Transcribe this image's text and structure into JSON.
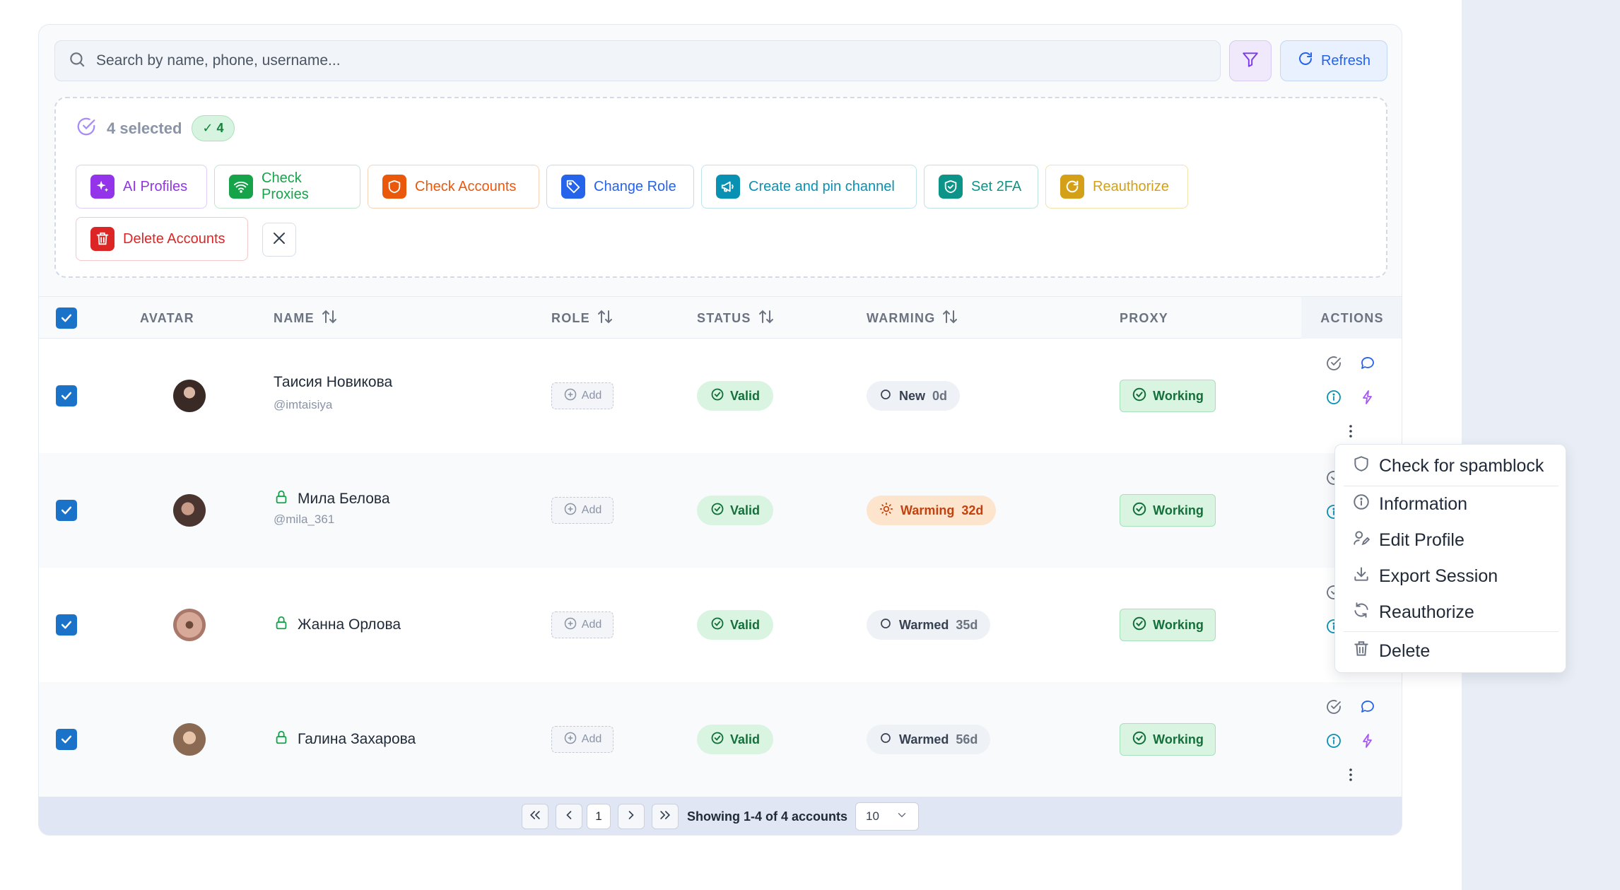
{
  "search": {
    "placeholder": "Search by name, phone, username..."
  },
  "toolbar": {
    "refresh_label": "Refresh"
  },
  "selection": {
    "count_label": "4 selected",
    "badge_label": "✓ 4",
    "actions": [
      {
        "label": "AI Profiles",
        "color": "#9333ea",
        "icon": "sparkles-icon"
      },
      {
        "label": "Check Proxies",
        "color": "#16a34a",
        "icon": "wifi-icon"
      },
      {
        "label": "Check Accounts",
        "color": "#ea580c",
        "icon": "shield-icon"
      },
      {
        "label": "Change Role",
        "color": "#2563eb",
        "icon": "tag-icon"
      },
      {
        "label": "Create and pin channel",
        "color": "#0891b2",
        "icon": "megaphone-icon"
      },
      {
        "label": "Set 2FA",
        "color": "#0d9488",
        "icon": "shield-check-icon"
      },
      {
        "label": "Reauthorize",
        "color": "#d4a017",
        "icon": "refresh-icon"
      },
      {
        "label": "Delete Accounts",
        "color": "#dc2626",
        "icon": "trash-icon"
      }
    ]
  },
  "table": {
    "headers": {
      "avatar": "AVATAR",
      "name": "NAME",
      "role": "ROLE",
      "status": "STATUS",
      "warming": "WARMING",
      "proxy": "PROXY",
      "actions": "ACTIONS"
    },
    "rows": [
      {
        "name": "Таисия Новикова",
        "username": "@imtaisiya",
        "role": "Add",
        "status": "Valid",
        "warming": "New",
        "warming_days": "0d",
        "proxy": "Working"
      },
      {
        "name": "Мила Белова",
        "username": "@mila_361",
        "role": "Add",
        "status": "Valid",
        "warming": "Warming",
        "warming_days": "32d",
        "proxy": "Working"
      },
      {
        "name": "Жанна Орлова",
        "username": "",
        "role": "Add",
        "status": "Valid",
        "warming": "Warmed",
        "warming_days": "35d",
        "proxy": "Working"
      },
      {
        "name": "Галина Захарова",
        "username": "",
        "role": "Add",
        "status": "Valid",
        "warming": "Warmed",
        "warming_days": "56d",
        "proxy": "Working"
      }
    ]
  },
  "pagination": {
    "current_page": "1",
    "info": "Showing 1-4 of 4 accounts",
    "page_size": "10"
  },
  "context_menu": {
    "items": [
      {
        "label": "Check for spamblock",
        "icon": "shield-outline-icon"
      },
      {
        "label": "Information",
        "icon": "info-icon"
      },
      {
        "label": "Edit Profile",
        "icon": "user-edit-icon"
      },
      {
        "label": "Export Session",
        "icon": "download-icon"
      },
      {
        "label": "Reauthorize",
        "icon": "refresh-icon"
      },
      {
        "label": "Delete",
        "icon": "trash-icon"
      }
    ]
  }
}
